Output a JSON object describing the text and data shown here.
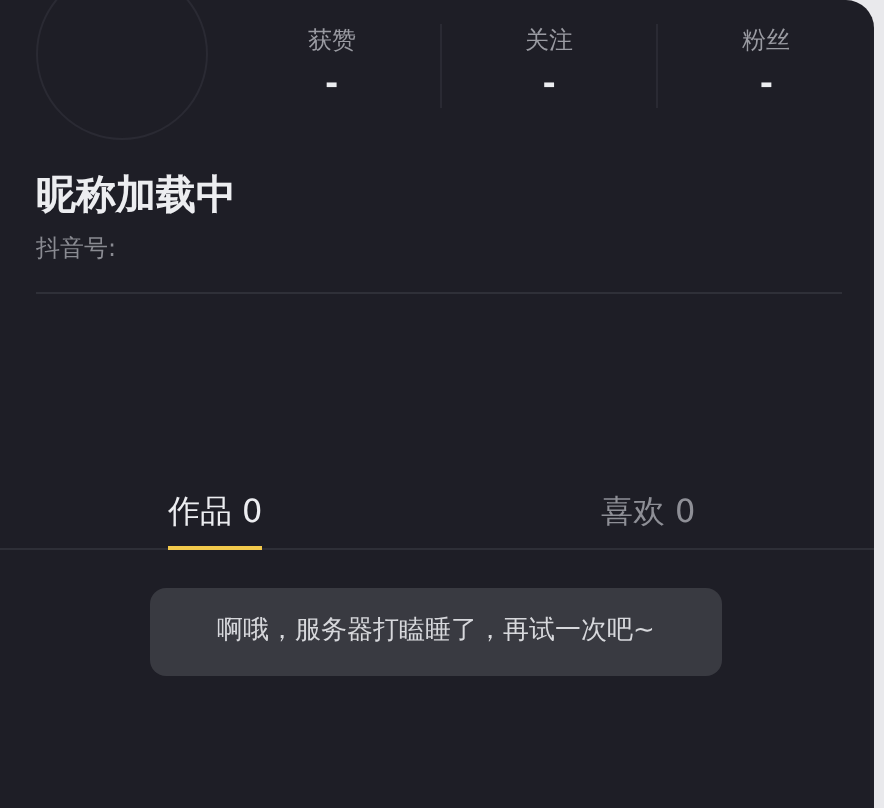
{
  "stats": [
    {
      "label": "获赞",
      "value": "-"
    },
    {
      "label": "关注",
      "value": "-"
    },
    {
      "label": "粉丝",
      "value": "-"
    }
  ],
  "profile": {
    "nickname": "昵称加载中",
    "id_label": "抖音号:"
  },
  "tabs": [
    {
      "label": "作品 0",
      "selected": true
    },
    {
      "label": "喜欢 0",
      "selected": false
    }
  ],
  "toast": {
    "message": "啊哦，服务器打瞌睡了，再试一次吧~"
  }
}
